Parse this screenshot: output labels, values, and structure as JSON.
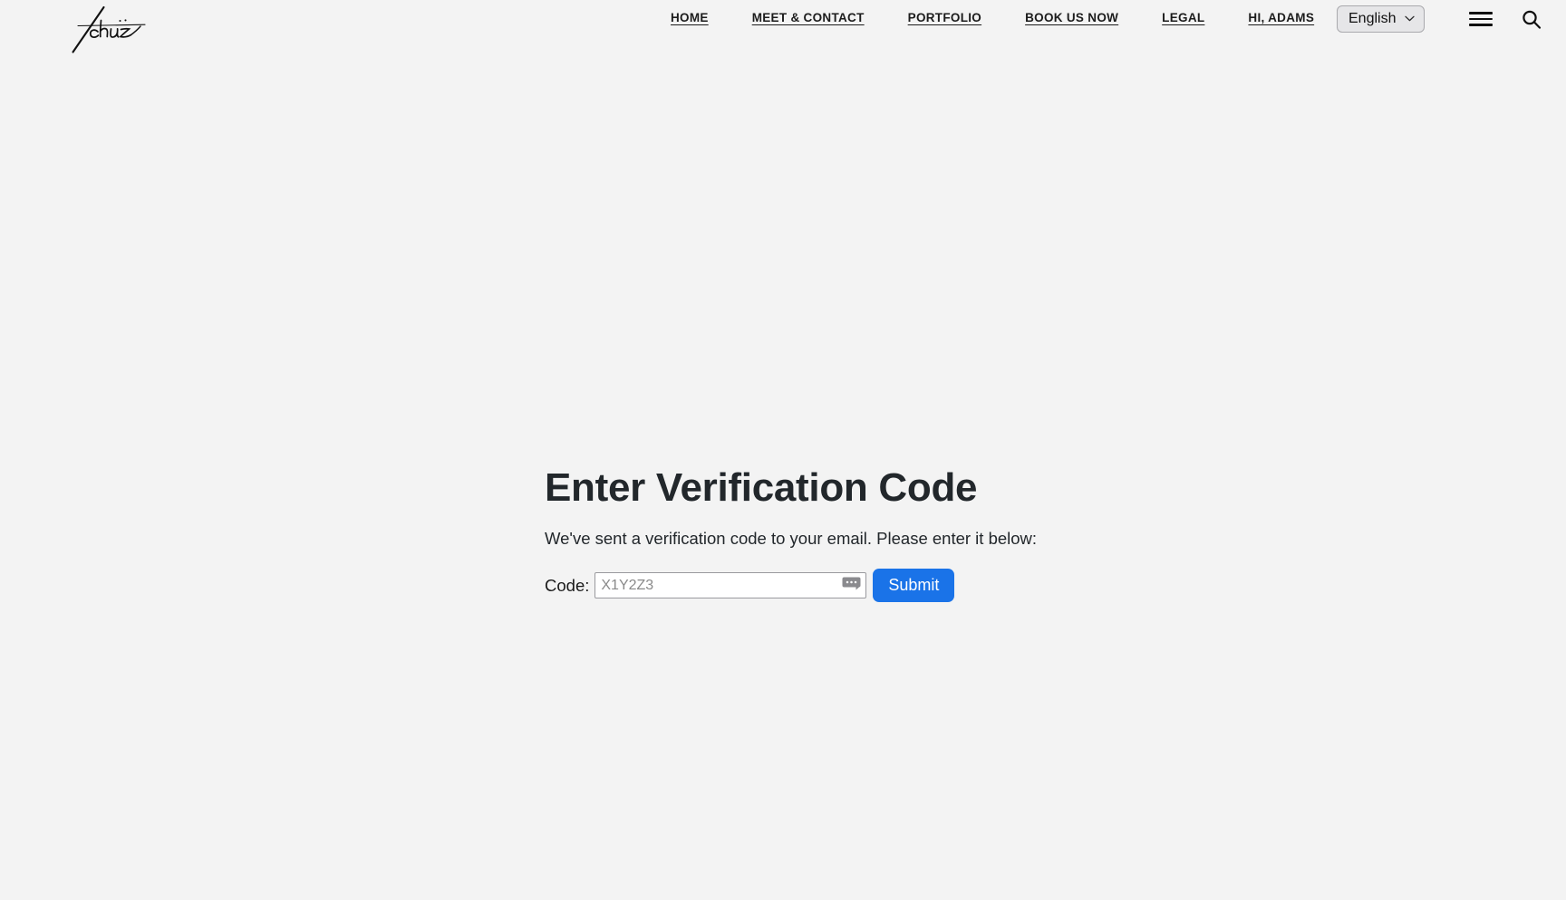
{
  "page": {
    "background_color": "#f3f3f3"
  },
  "header": {
    "logo": {
      "icon": "signature-logo",
      "alt": "Tchuz"
    },
    "nav_items": [
      {
        "label": "HOME",
        "name": "nav-item-home"
      },
      {
        "label": "MEET & CONTACT",
        "name": "nav-item-meet-contact"
      },
      {
        "label": "PORTFOLIO",
        "name": "nav-item-portfolio"
      },
      {
        "label": "BOOK US NOW",
        "name": "nav-item-book-us-now"
      },
      {
        "label": "LEGAL",
        "name": "nav-item-legal"
      },
      {
        "label": "HI, ADAMS",
        "name": "nav-item-account"
      }
    ],
    "language_select": {
      "selected": "English",
      "options": [
        "English"
      ],
      "chevron_icon": "chevron-down-icon"
    },
    "menu_icon": "hamburger-menu-icon",
    "search_icon": "search-icon"
  },
  "main": {
    "title": "Enter Verification Code",
    "instructions": "We've sent a verification code to your email. Please enter it below:",
    "form": {
      "code_label": "Code:",
      "code_value": "",
      "code_placeholder": "X1Y2Z3",
      "autofill_icon": "autofill-hint-icon",
      "submit_label": "Submit",
      "submit_color": "#1a73e8"
    }
  }
}
